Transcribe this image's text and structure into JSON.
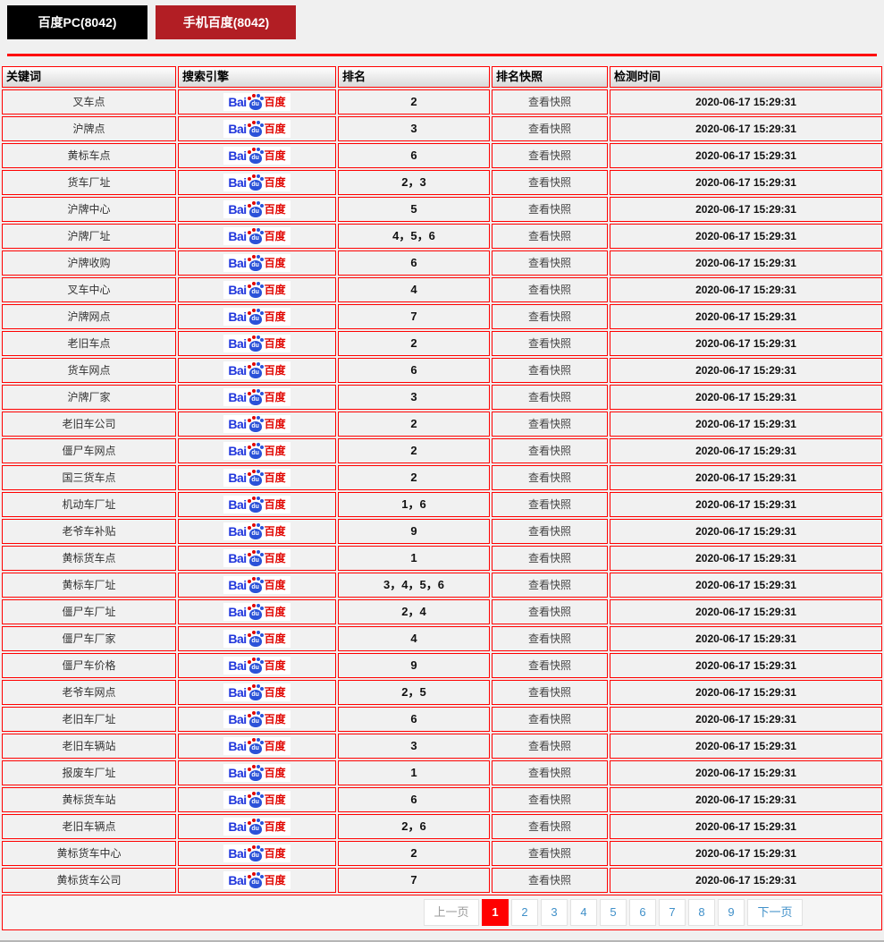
{
  "tabs": {
    "pc_label": "百度PC(8042)",
    "mobile_label": "手机百度(8042)"
  },
  "table": {
    "headers": [
      "关键词",
      "搜索引擎",
      "排名",
      "排名快照",
      "检测时间"
    ],
    "snapshot_label": "查看快照",
    "detect_time": "2020-06-17 15:29:31",
    "rows": [
      {
        "keyword": "叉车点",
        "rank": "2"
      },
      {
        "keyword": "沪牌点",
        "rank": "3"
      },
      {
        "keyword": "黄标车点",
        "rank": "6"
      },
      {
        "keyword": "货车厂址",
        "rank": "2，3"
      },
      {
        "keyword": "沪牌中心",
        "rank": "5"
      },
      {
        "keyword": "沪牌厂址",
        "rank": "4，5，6"
      },
      {
        "keyword": "沪牌收购",
        "rank": "6"
      },
      {
        "keyword": "叉车中心",
        "rank": "4"
      },
      {
        "keyword": "沪牌网点",
        "rank": "7"
      },
      {
        "keyword": "老旧车点",
        "rank": "2"
      },
      {
        "keyword": "货车网点",
        "rank": "6"
      },
      {
        "keyword": "沪牌厂家",
        "rank": "3"
      },
      {
        "keyword": "老旧车公司",
        "rank": "2"
      },
      {
        "keyword": "僵尸车网点",
        "rank": "2"
      },
      {
        "keyword": "国三货车点",
        "rank": "2"
      },
      {
        "keyword": "机动车厂址",
        "rank": "1，6"
      },
      {
        "keyword": "老爷车补贴",
        "rank": "9"
      },
      {
        "keyword": "黄标货车点",
        "rank": "1"
      },
      {
        "keyword": "黄标车厂址",
        "rank": "3，4，5，6"
      },
      {
        "keyword": "僵尸车厂址",
        "rank": "2，4"
      },
      {
        "keyword": "僵尸车厂家",
        "rank": "4"
      },
      {
        "keyword": "僵尸车价格",
        "rank": "9"
      },
      {
        "keyword": "老爷车网点",
        "rank": "2，5"
      },
      {
        "keyword": "老旧车厂址",
        "rank": "6"
      },
      {
        "keyword": "老旧车辆站",
        "rank": "3"
      },
      {
        "keyword": "报废车厂址",
        "rank": "1"
      },
      {
        "keyword": "黄标货车站",
        "rank": "6"
      },
      {
        "keyword": "老旧车辆点",
        "rank": "2，6"
      },
      {
        "keyword": "黄标货车中心",
        "rank": "2"
      },
      {
        "keyword": "黄标货车公司",
        "rank": "7"
      }
    ]
  },
  "logo": {
    "bai": "Bai",
    "du": "du",
    "cn": "百度"
  },
  "pagination": {
    "prev_label": "上一页",
    "next_label": "下一页",
    "pages": [
      "1",
      "2",
      "3",
      "4",
      "5",
      "6",
      "7",
      "8",
      "9"
    ],
    "active_page": "1"
  },
  "colors": {
    "tab_pc_bg": "#000000",
    "tab_mobile_bg": "#b21e24",
    "table_border": "#ff0000",
    "row_bg": "#f1f1f1",
    "active_page_bg": "#ff0000",
    "page_link": "#4090c9",
    "baidu_blue": "#2b52d8",
    "baidu_red": "#e10602"
  }
}
